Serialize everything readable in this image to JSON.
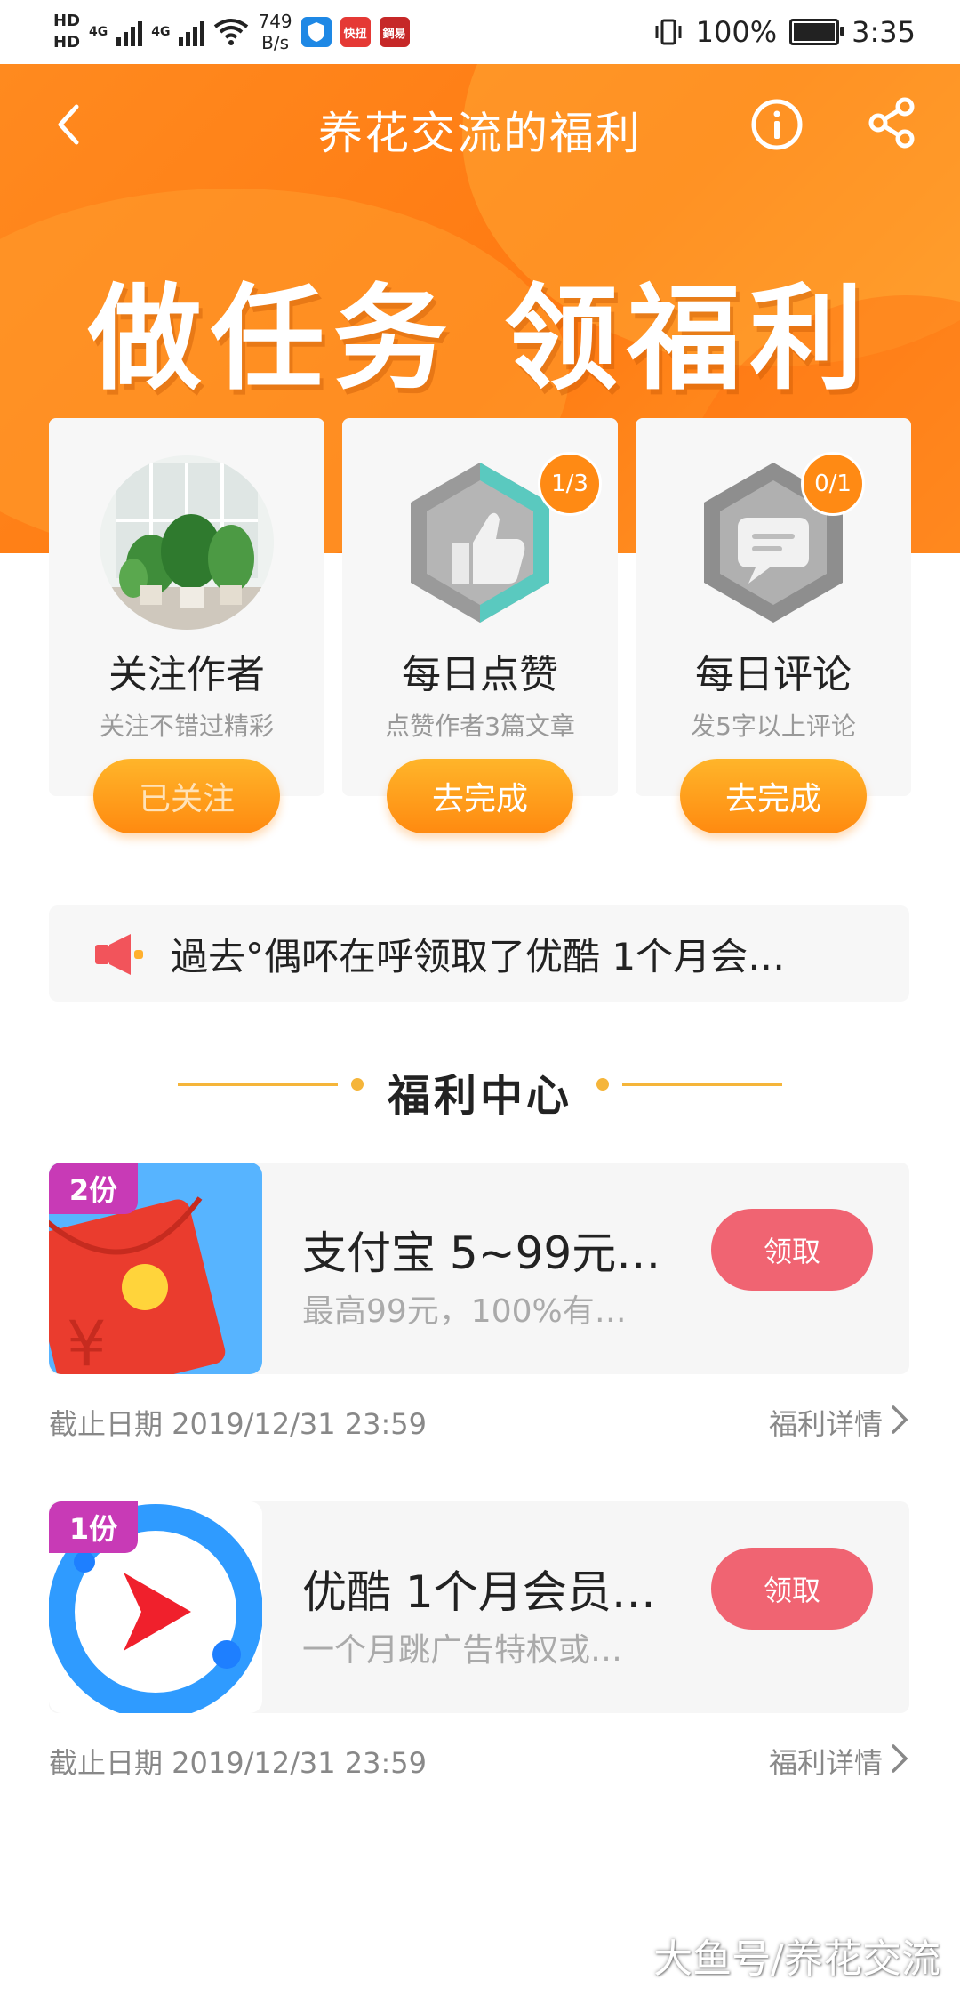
{
  "status_bar": {
    "hd_top": "HD",
    "hd_bottom": "HD",
    "net_left": "4G",
    "net_right": "4G",
    "speed_value": "749",
    "speed_unit": "B/s",
    "app_icon_1": "快扭",
    "app_icon_2": "鋼易",
    "battery_percent": "100%",
    "time": "3:35"
  },
  "header": {
    "title": "养花交流的福利",
    "banner": "做任务 领福利"
  },
  "tasks": [
    {
      "name": "关注作者",
      "desc": "关注不错过精彩",
      "button": "已关注",
      "progress": ""
    },
    {
      "name": "每日点赞",
      "desc": "点赞作者3篇文章",
      "button": "去完成",
      "progress": "1/3"
    },
    {
      "name": "每日评论",
      "desc": "发5字以上评论",
      "button": "去完成",
      "progress": "0/1"
    }
  ],
  "notice": {
    "text": "過去°偶吥在呼领取了优酷 1个月会…"
  },
  "section": {
    "title": "福利中心"
  },
  "rewards": [
    {
      "tag": "2份",
      "title": "支付宝 5~99元…",
      "subtitle": "最高99元，100%有…",
      "button": "领取",
      "deadline": "截止日期 2019/12/31 23:59",
      "detail": "福利详情"
    },
    {
      "tag": "1份",
      "title": "优酷 1个月会员…",
      "subtitle": "一个月跳广告特权或…",
      "button": "领取",
      "deadline": "截止日期 2019/12/31 23:59",
      "detail": "福利详情"
    }
  ],
  "watermark": "大鱼号/养花交流",
  "colors": {
    "brand_orange": "#ff8a14",
    "claim_red": "#f06472",
    "tag_purple": "#c83ab6",
    "divider_gold": "#f5b53a"
  },
  "icons": {
    "back": "chevron-left-icon",
    "info": "info-icon",
    "share": "share-icon",
    "notice": "speaker-icon",
    "detail": "chevron-right-icon"
  }
}
